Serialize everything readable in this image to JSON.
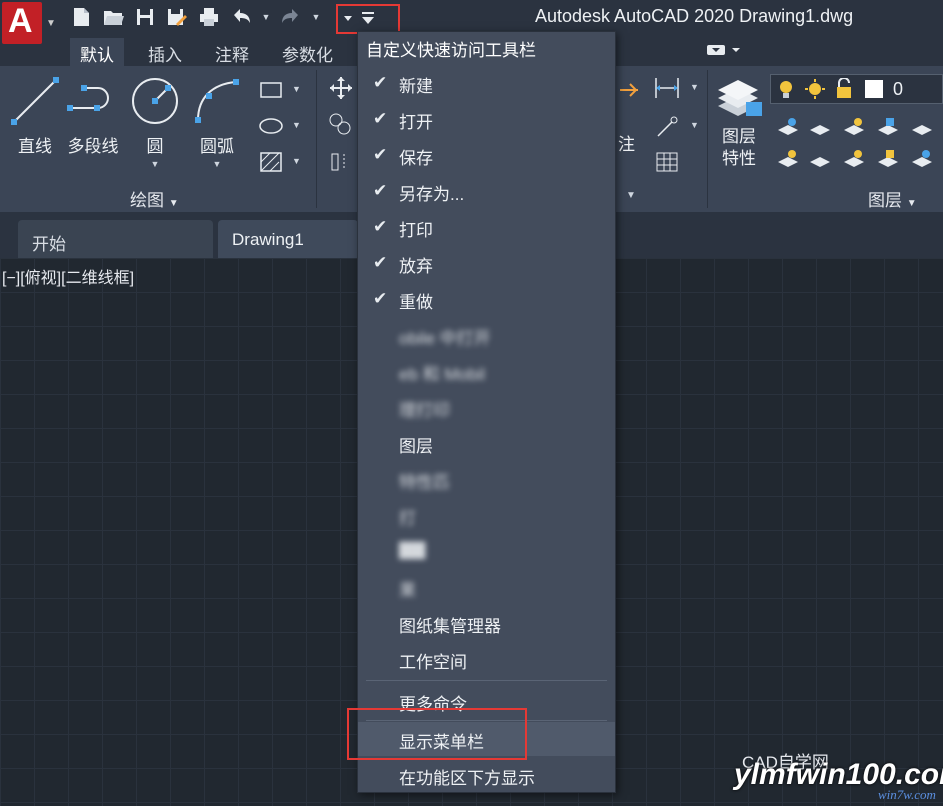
{
  "window": {
    "title": "Autodesk AutoCAD 2020    Drawing1.dwg",
    "logo_letter": "A"
  },
  "qat": {
    "icons": [
      "new-file-icon",
      "open-folder-icon",
      "save-icon",
      "save-as-icon",
      "print-icon",
      "undo-icon",
      "redo-icon"
    ]
  },
  "ribbon_tabs": [
    "默认",
    "插入",
    "注释",
    "参数化"
  ],
  "ribbon": {
    "draw_tools": [
      "直线",
      "多段线",
      "圆",
      "圆弧"
    ],
    "draw_panel": "绘图",
    "annotate_partial": "注",
    "layer_props": [
      "图层",
      "特性"
    ],
    "layer_panel": "图层",
    "layer_current": "0"
  },
  "doc_tabs": [
    "开始",
    "Drawing1"
  ],
  "viewport_label": "[−][俯视][二维线框]",
  "menu": {
    "header": "自定义快速访问工具栏",
    "items": [
      {
        "label": "新建",
        "checked": true
      },
      {
        "label": "打开",
        "checked": true
      },
      {
        "label": "保存",
        "checked": true
      },
      {
        "label": "另存为...",
        "checked": true
      },
      {
        "label": "打印",
        "checked": true
      },
      {
        "label": "放弃",
        "checked": true
      },
      {
        "label": "重做",
        "checked": true
      },
      {
        "label": "obile 中打开",
        "checked": false,
        "blurred": true
      },
      {
        "label": "eb 和 Mobil",
        "checked": false,
        "blurred": true
      },
      {
        "label": "理打印",
        "checked": false,
        "blurred": true
      },
      {
        "label": "图层",
        "checked": false
      },
      {
        "label": "特性匹",
        "checked": false,
        "blurred": true
      },
      {
        "label": "打",
        "checked": false,
        "blurred": true
      },
      {
        "label": "",
        "checked": false,
        "blurred": true
      },
      {
        "label": "果",
        "checked": false,
        "blurred": true
      },
      {
        "label": "图纸集管理器",
        "checked": false
      },
      {
        "label": "工作空间",
        "checked": false
      },
      {
        "label": "更多命令...",
        "checked": false
      },
      {
        "label": "显示菜单栏",
        "checked": false
      },
      {
        "label": "在功能区下方显示",
        "checked": false
      }
    ]
  },
  "watermark": {
    "wechat": "CAD自学网",
    "site": "ylmfwin100.com",
    "site2": "win7w.com"
  },
  "colors": {
    "accent_red": "#e53935",
    "menu_bg": "#434c5c",
    "ribbon_bg": "#3b4556",
    "canvas_bg": "#212830"
  }
}
